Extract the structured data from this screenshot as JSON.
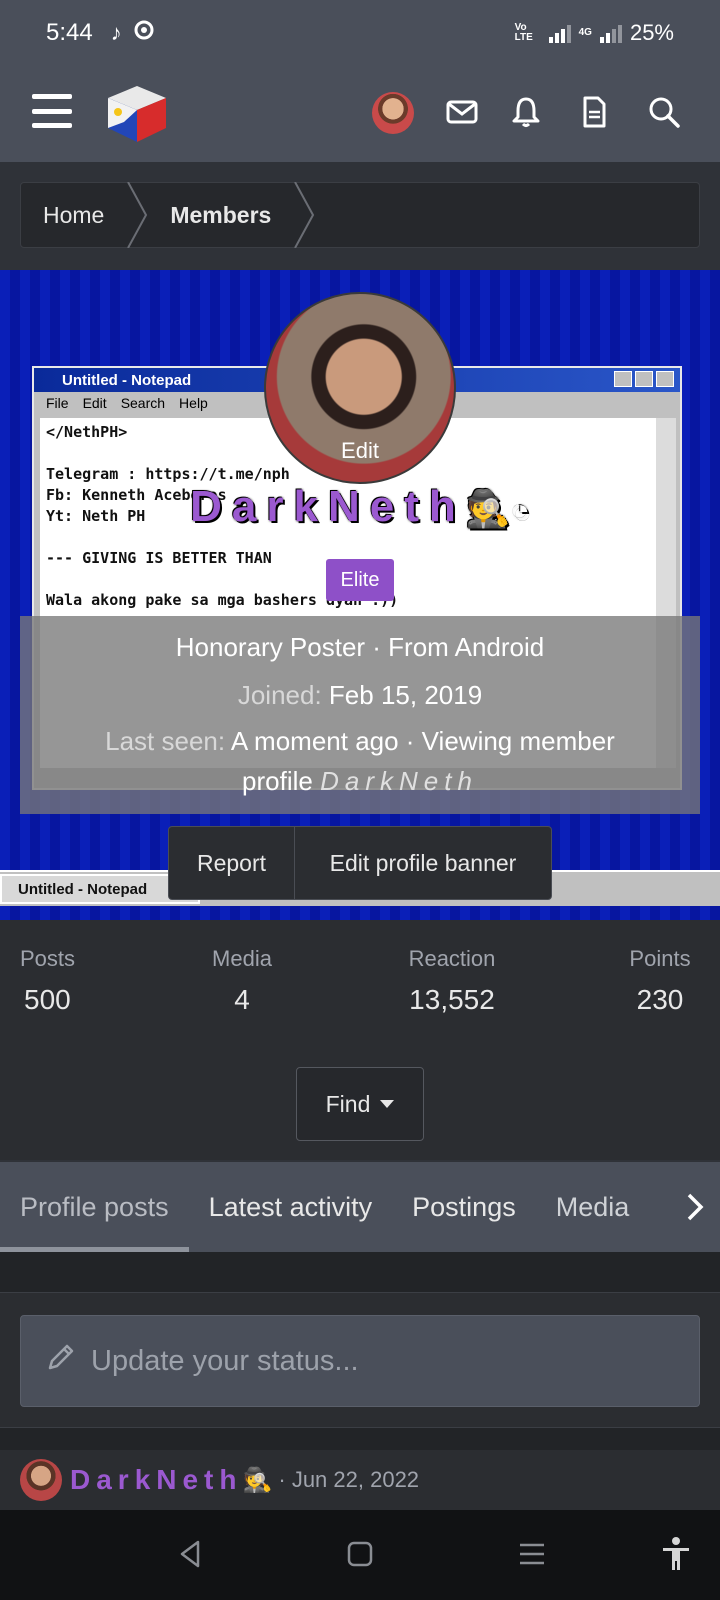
{
  "status_bar": {
    "time": "5:44",
    "network_label": "Vo LTE",
    "network_type": "4G",
    "battery": "25%"
  },
  "header": {
    "icons": [
      "menu-icon",
      "site-logo",
      "user-avatar",
      "mail-icon",
      "bell-icon",
      "document-icon",
      "search-icon"
    ]
  },
  "breadcrumb": {
    "items": [
      "Home",
      "Members"
    ]
  },
  "banner": {
    "notepad_title": "Untitled - Notepad",
    "notepad_menu": [
      "File",
      "Edit",
      "Search",
      "Help"
    ],
    "notepad_lines": [
      "</NethPH>",
      "",
      "Telegram : https://t.me/nph",
      "Fb: Kenneth Aceberos",
      "Yt: Neth PH",
      "",
      "--- GIVING IS BETTER THAN",
      "",
      "Wala akong pake sa mga bashers dyan :))"
    ],
    "taskbar_label": "Untitled - Notepad"
  },
  "profile": {
    "avatar_edit_label": "Edit",
    "username": "DarkNeth",
    "badge": "Elite",
    "title_line": "Honorary Poster · From Android",
    "joined_label": "Joined:",
    "joined_value": "Feb 15, 2019",
    "last_seen_label": "Last seen:",
    "last_seen_value": "A moment ago · Viewing member",
    "last_seen_value2": "profile",
    "last_seen_name": "DarkNeth"
  },
  "actions": {
    "report": "Report",
    "edit_banner": "Edit profile banner"
  },
  "stats": [
    {
      "label": "Posts",
      "value": "500"
    },
    {
      "label": "Media",
      "value": "4"
    },
    {
      "label": "Reaction",
      "value": "13,552"
    },
    {
      "label": "Points",
      "value": "230"
    }
  ],
  "find_label": "Find",
  "tabs": [
    "Profile posts",
    "Latest activity",
    "Postings",
    "Media"
  ],
  "status_input": {
    "placeholder": "Update your status..."
  },
  "post": {
    "author": "DarkNeth",
    "date": "· Jun 22, 2022"
  },
  "colors": {
    "accent_purple": "#8e50c8",
    "username_purple": "#9b59d0",
    "header_bg": "#4a4f5a",
    "page_bg": "#2b2d31"
  }
}
